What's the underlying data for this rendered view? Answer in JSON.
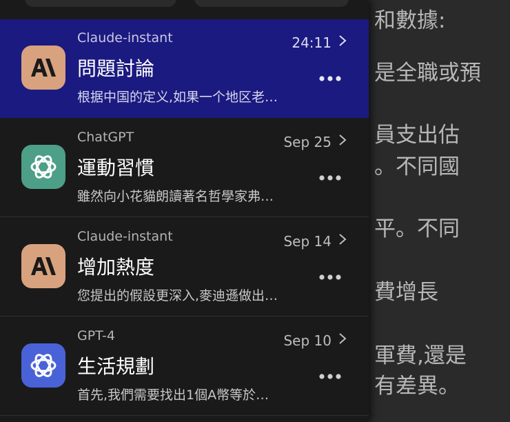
{
  "background_chat": {
    "lines": [
      "和數據:",
      "是全職或預",
      "員支出估",
      "。不同國",
      "平。不同",
      "費增長",
      "軍費,還是",
      "有差異。"
    ]
  },
  "conversations": [
    {
      "model": "Claude-instant",
      "title": "問題討論",
      "preview": "根据中国的定义,如果一个地区老…",
      "date": "24:11",
      "icon": "claude-icon",
      "active": true
    },
    {
      "model": "ChatGPT",
      "title": "運動習慣",
      "preview": "雖然向小花貓朗讀著名哲學家弗…",
      "date": "Sep 25",
      "icon": "chatgpt-icon",
      "active": false
    },
    {
      "model": "Claude-instant",
      "title": "增加熱度",
      "preview": "您提出的假設更深入,麥迪遜做出…",
      "date": "Sep 14",
      "icon": "claude-icon",
      "active": false
    },
    {
      "model": "GPT-4",
      "title": "生活規劃",
      "preview": "首先,我們需要找出1個A幣等於…",
      "date": "Sep 10",
      "icon": "gpt4-icon",
      "active": false
    }
  ],
  "colors": {
    "active_row": "#1b1a80",
    "claude": "#d8a27f",
    "chatgpt": "#4d9f87",
    "gpt4": "#4a62d8"
  }
}
